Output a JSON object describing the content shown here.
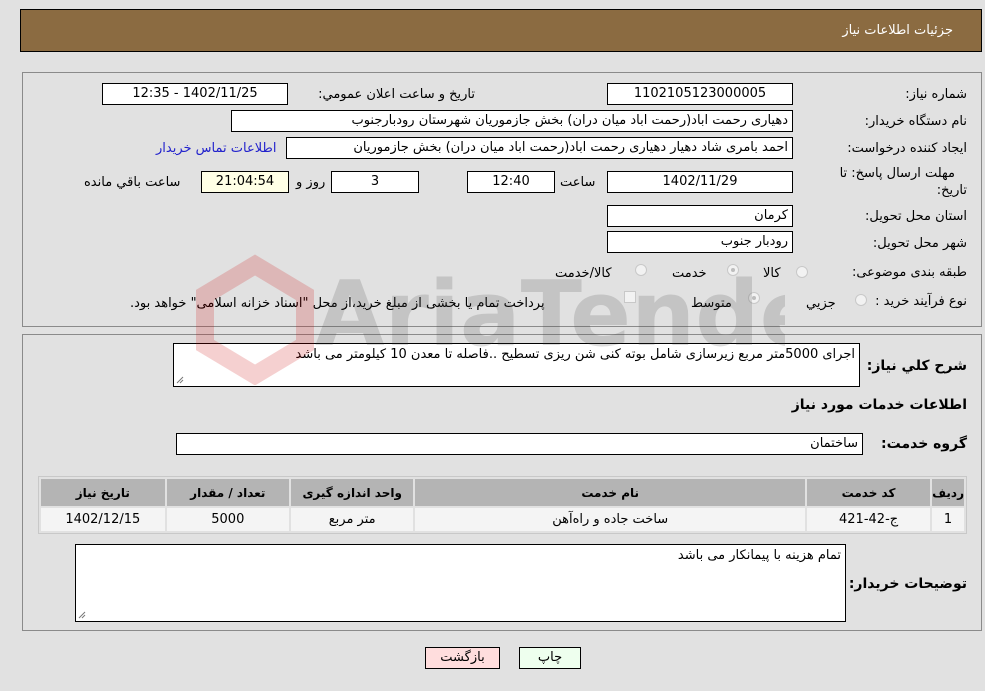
{
  "header": {
    "title": "جزئیات اطلاعات نیاز"
  },
  "fields": {
    "need_number_label": "شماره نیاز:",
    "need_number": "1102105123000005",
    "announce_label": "تاریخ و ساعت اعلان عمومي:",
    "announce_value": "1402/11/25 - 12:35",
    "buyer_org_label": "نام دستگاه خريدار:",
    "buyer_org": "دهیاری رحمت اباد(رحمت اباد میان دران) بخش جازموریان شهرستان رودبارجنوب",
    "creator_label": "ایجاد کننده درخواست:",
    "creator": "احمد بامری شاد دهیار دهیاری رحمت اباد(رحمت اباد میان دران) بخش جازموریان",
    "contact_link": "اطلاعات تماس خريدار",
    "deadline_label_line1": "مهلت ارسال پاسخ: تا",
    "deadline_label_line2": "تاریخ:",
    "deadline_date": "1402/11/29",
    "time_label": "ساعت",
    "deadline_time": "12:40",
    "days_value": "3",
    "days_label": "روز و",
    "remaining_time": "21:04:54",
    "remaining_label": "ساعت باقي مانده",
    "province_label": "استان محل تحویل:",
    "province": "کرمان",
    "city_label": "شهر محل تحویل:",
    "city": "رودبار جنوب",
    "category_label": "طبقه بندی موضوعی:",
    "category_options": [
      {
        "label": "کالا",
        "selected": false
      },
      {
        "label": "خدمت",
        "selected": true
      },
      {
        "label": "کالا/خدمت",
        "selected": false
      }
    ],
    "process_label": "نوع فرآیند خرید :",
    "process_options": [
      {
        "label": "جزيي",
        "selected": false
      },
      {
        "label": "متوسط",
        "selected": true
      }
    ],
    "payment_note": "پرداخت تمام یا بخشی از مبلغ خرید،از محل \"اسناد خزانه اسلامی\" خواهد بود.",
    "payment_checked": false
  },
  "description": {
    "label": "شرح کلي نياز:",
    "value": "اجرای 5000متر مربع زیرسازی شامل بوته کنی شن ریزی تسطیح ..فاصله تا معدن 10 کیلومتر می باشد"
  },
  "services": {
    "section_title": "اطلاعات خدمات مورد نياز",
    "group_label": "گروه خدمت:",
    "group_value": "ساختمان",
    "table": {
      "columns": [
        "ردیف",
        "کد خدمت",
        "نام خدمت",
        "واحد اندازه گیری",
        "تعداد / مقدار",
        "تاریخ نیاز"
      ],
      "rows": [
        [
          "1",
          "ج-42-421",
          "ساخت جاده و راه‌آهن",
          "متر مربع",
          "5000",
          "1402/12/15"
        ]
      ]
    }
  },
  "buyer_notes": {
    "label": "توضيحات خريدار:",
    "value": "تمام هزینه با پیمانکار می باشد"
  },
  "buttons": {
    "print": "چاپ",
    "back": "بازگشت"
  },
  "colors": {
    "header_bg": "#8b6b41",
    "print_bg": "#eeffee",
    "back_bg": "#ffdddd",
    "link": "#2222cc"
  }
}
